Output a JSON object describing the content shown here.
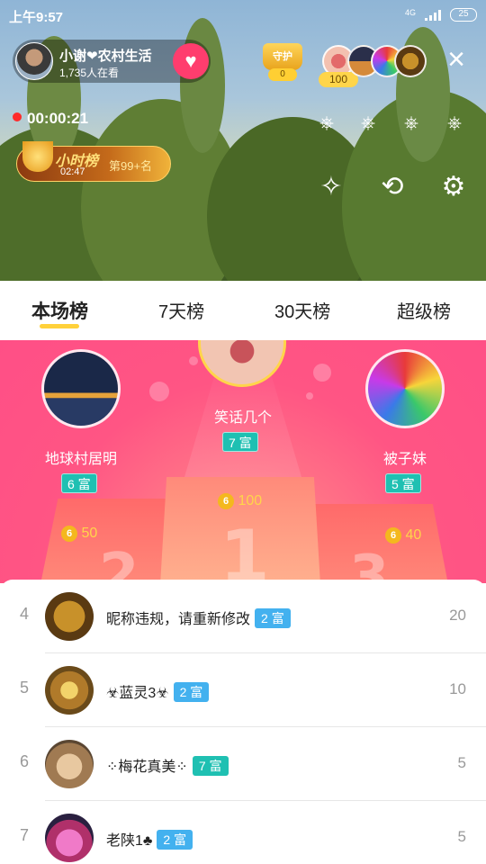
{
  "status_bar": {
    "time": "上午9:57",
    "network": "4G",
    "battery": "25"
  },
  "host": {
    "name": "小谢❤农村生活",
    "viewers": "1,735人在看",
    "follow_icon": "heart-plus-icon"
  },
  "guard": {
    "label": "守护",
    "count": "0"
  },
  "top_viewer_count": "100",
  "recording": {
    "elapsed": "00:00:21"
  },
  "hourly_rank": {
    "title": "小时榜",
    "time_left": "02:47",
    "rank": "第99+名"
  },
  "tabs": [
    {
      "label": "本场榜",
      "active": true
    },
    {
      "label": "7天榜",
      "active": false
    },
    {
      "label": "30天榜",
      "active": false
    },
    {
      "label": "超级榜",
      "active": false
    }
  ],
  "podium": {
    "first": {
      "name": "笑话几个",
      "level": "7 富",
      "score": "100",
      "place": "1"
    },
    "second": {
      "name": "地球村居明",
      "level": "6 富",
      "score": "50",
      "place": "2"
    },
    "third": {
      "name": "被子妹",
      "level": "5 富",
      "score": "40",
      "place": "3"
    },
    "coin_symbol": "6"
  },
  "ranking_list": [
    {
      "rank": "4",
      "name": "昵称违规，请重新修改",
      "level": "2 富",
      "score": "20"
    },
    {
      "rank": "5",
      "name": "☣蓝灵3☣",
      "level": "2 富",
      "score": "10"
    },
    {
      "rank": "6",
      "name": "⁘梅花真美⁘",
      "level": "7 富",
      "score": "5"
    },
    {
      "rank": "7",
      "name": "老陕1♣",
      "level": "2 富",
      "score": "5"
    }
  ],
  "colors": {
    "accent_pink": "#ff4f86",
    "tab_underline": "#ffd13a",
    "badge_blue": "#43b1ef",
    "badge_teal": "#1fc0b2",
    "coin": "#f4b81e"
  }
}
